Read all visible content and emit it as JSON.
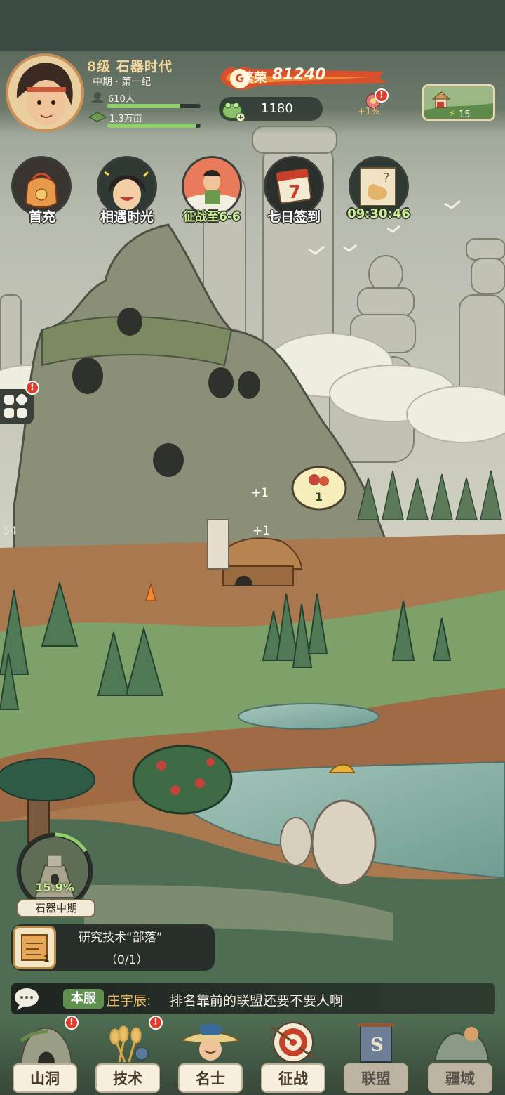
{
  "player": {
    "level_title": "8级 石器时代",
    "era_sub": "中期 · 第一纪",
    "population": "610人",
    "land": "1.3万亩",
    "population_fill": 0.78,
    "land_fill": 0.95
  },
  "prosperity": {
    "label": "繁荣",
    "value": "81240"
  },
  "resource": {
    "value": "1180",
    "icon": "frog-coin-icon"
  },
  "bonus": {
    "value": "+1%",
    "badge": "!"
  },
  "land_card": {
    "count": "15"
  },
  "events": [
    {
      "label": "首充",
      "icon": "gift-bag-icon",
      "highlight": false
    },
    {
      "label": "相遇时光",
      "icon": "girl-portrait-icon",
      "highlight": false
    },
    {
      "label": "征战至6-6",
      "icon": "warrior-icon",
      "highlight": true
    },
    {
      "label": "七日签到",
      "icon": "calendar-7-icon",
      "highlight": false
    },
    {
      "label": "09:30:46",
      "icon": "scroll-dog-icon",
      "highlight": true
    }
  ],
  "side_menu": {
    "badge": "!"
  },
  "edge_number": "54",
  "map": {
    "plus_one_a": "+1",
    "plus_one_b": "+1",
    "fruit_bubble": "1"
  },
  "era_badge": {
    "percent": "15.9%",
    "progress": 0.159,
    "label": "石器中期"
  },
  "research": {
    "title": "研究技术“部落”",
    "progress": "（0/1）",
    "icon_num": "1"
  },
  "chat": {
    "channel": "本服",
    "speaker": "庄宇辰:",
    "message": "排名靠前的联盟还要不要人啊"
  },
  "nav": [
    {
      "label": "山洞",
      "icon": "cave-icon",
      "badge": "!",
      "active": true
    },
    {
      "label": "技术",
      "icon": "wheat-icon",
      "badge": "!",
      "active": true
    },
    {
      "label": "名士",
      "icon": "sage-icon",
      "badge": "",
      "active": true
    },
    {
      "label": "征战",
      "icon": "target-icon",
      "badge": "",
      "active": true
    },
    {
      "label": "联盟",
      "icon": "banner-icon",
      "badge": "",
      "active": false
    },
    {
      "label": "疆域",
      "icon": "territory-icon",
      "badge": "",
      "active": false
    }
  ]
}
